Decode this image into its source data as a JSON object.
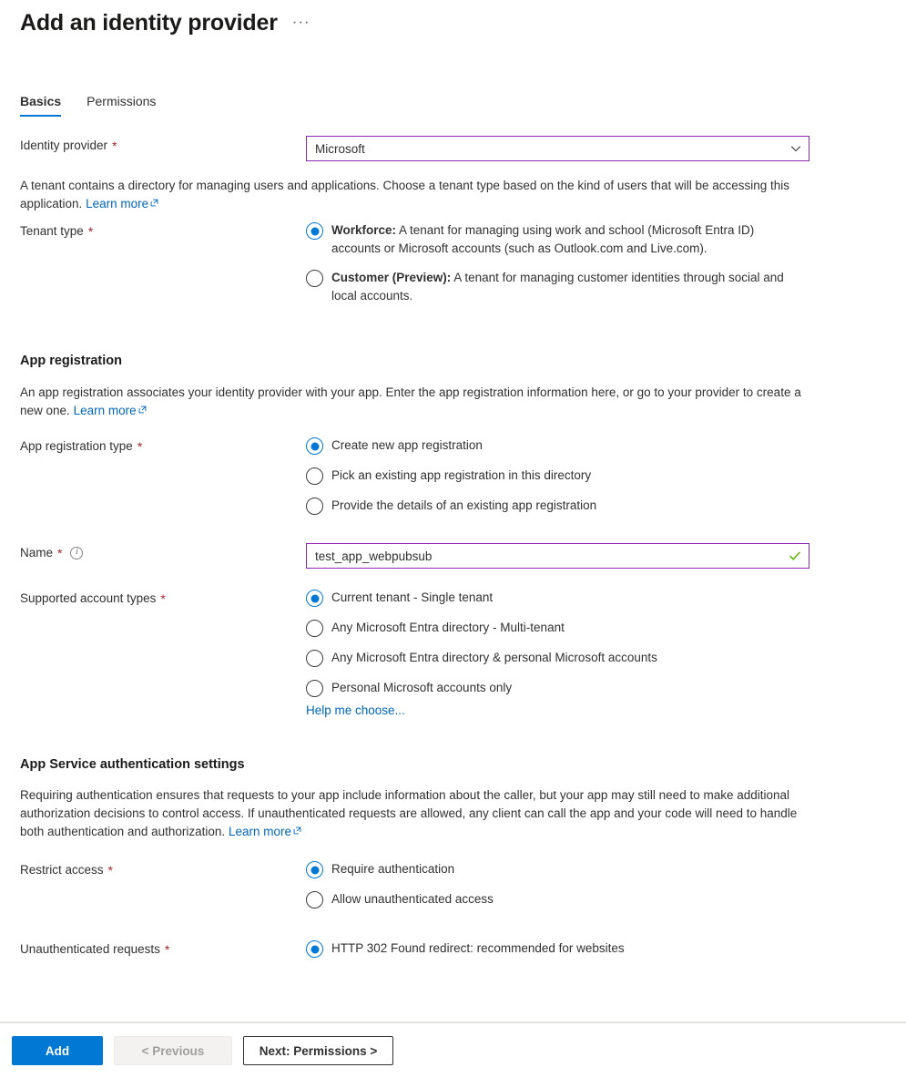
{
  "header": {
    "title": "Add an identity provider",
    "more_menu": "···"
  },
  "tabs": [
    {
      "label": "Basics",
      "active": true
    },
    {
      "label": "Permissions",
      "active": false
    }
  ],
  "identity_provider": {
    "label": "Identity provider",
    "required": "*",
    "value": "Microsoft"
  },
  "tenant_intro": {
    "text": "A tenant contains a directory for managing users and applications. Choose a tenant type based on the kind of users that will be accessing this application.",
    "link": "Learn more"
  },
  "tenant_type": {
    "label": "Tenant type",
    "required": "*",
    "options": [
      {
        "strong": "Workforce:",
        "text": " A tenant for managing using work and school (Microsoft Entra ID) accounts or Microsoft accounts (such as Outlook.com and Live.com).",
        "selected": true
      },
      {
        "strong": "Customer (Preview):",
        "text": " A tenant for managing customer identities through social and local accounts.",
        "selected": false
      }
    ]
  },
  "app_registration": {
    "title": "App registration",
    "description": "An app registration associates your identity provider with your app. Enter the app registration information here, or go to your provider to create a new one.",
    "link": "Learn more",
    "type_label": "App registration type",
    "type_required": "*",
    "type_options": [
      {
        "label": "Create new app registration",
        "selected": true
      },
      {
        "label": "Pick an existing app registration in this directory",
        "selected": false
      },
      {
        "label": "Provide the details of an existing app registration",
        "selected": false
      }
    ],
    "name_label": "Name",
    "name_required": "*",
    "name_value": "test_app_webpubsub",
    "name_valid": true,
    "account_types_label": "Supported account types",
    "account_types_required": "*",
    "account_types_options": [
      {
        "label": "Current tenant - Single tenant",
        "selected": true
      },
      {
        "label": "Any Microsoft Entra directory - Multi-tenant",
        "selected": false
      },
      {
        "label": "Any Microsoft Entra directory & personal Microsoft accounts",
        "selected": false
      },
      {
        "label": "Personal Microsoft accounts only",
        "selected": false
      }
    ],
    "help_link": "Help me choose..."
  },
  "auth_settings": {
    "title": "App Service authentication settings",
    "description": "Requiring authentication ensures that requests to your app include information about the caller, but your app may still need to make additional authorization decisions to control access. If unauthenticated requests are allowed, any client can call the app and your code will need to handle both authentication and authorization.",
    "link": "Learn more",
    "restrict_label": "Restrict access",
    "restrict_required": "*",
    "restrict_options": [
      {
        "label": "Require authentication",
        "selected": true
      },
      {
        "label": "Allow unauthenticated access",
        "selected": false
      }
    ],
    "unauth_label": "Unauthenticated requests",
    "unauth_required": "*",
    "unauth_options": [
      {
        "label": "HTTP 302 Found redirect: recommended for websites",
        "selected": true
      }
    ]
  },
  "footer": {
    "add_label": "Add",
    "previous_label": "< Previous",
    "next_label": "Next: Permissions >"
  },
  "colors": {
    "accent": "#0078d4",
    "link": "#0067b8",
    "required": "#a4262c",
    "input_border": "#8c28b4",
    "valid_check": "#5cb300"
  }
}
